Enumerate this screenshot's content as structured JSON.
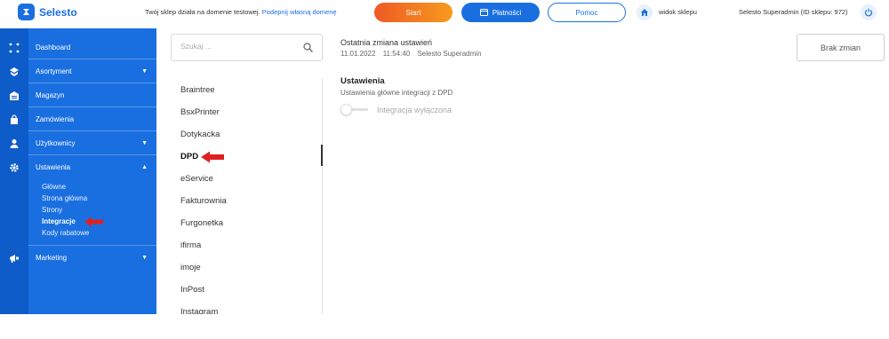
{
  "topbar": {
    "logo_text": "Selesto",
    "domain_note": "Twój sklep działa na domenie testowej.",
    "domain_link": "Podepnij własną domenę",
    "start_label": "Start",
    "payments_label": "Płatności",
    "help_label": "Pomoc",
    "shop_view_label": "widok sklepu",
    "user_info": "Selesto Superadmin (ID sklepu: 972)"
  },
  "sidebar": {
    "items": [
      {
        "label": "Dashboard"
      },
      {
        "label": "Asortyment",
        "caret": "▼"
      },
      {
        "label": "Magazyn"
      },
      {
        "label": "Zamówienia"
      },
      {
        "label": "Użytkownicy",
        "caret": "▼"
      },
      {
        "label": "Ustawienia",
        "caret": "▲"
      },
      {
        "label": "Marketing",
        "caret": "▼"
      }
    ],
    "subitems": [
      {
        "label": "Główne"
      },
      {
        "label": "Strona główna"
      },
      {
        "label": "Strony"
      },
      {
        "label": "Integracje",
        "active": true
      },
      {
        "label": "Kody rabatowe"
      }
    ]
  },
  "search": {
    "placeholder": "Szukaj ..."
  },
  "integrations": {
    "items": [
      "Braintree",
      "BsxPrinter",
      "Dotykacka",
      "DPD",
      "eService",
      "Fakturownia",
      "Furgonetka",
      "ifirma",
      "imoje",
      "InPost",
      "Instagram"
    ],
    "active": "DPD"
  },
  "header": {
    "last_change_label": "Ostatnia zmiana ustawień",
    "date": "11.01.2022",
    "time": "11:54:40",
    "author": "Selesto Superadmin",
    "no_changes_label": "Brak zmian"
  },
  "settings": {
    "title": "Ustawienia",
    "subtitle": "Ustawienia główne integracji z DPD",
    "toggle_label": "Integracja wyłączona",
    "toggle_on": false
  },
  "colors": {
    "brand_blue": "#1a6fe0",
    "sidebar_dark": "#0e5cc9",
    "start_orange": "#ee5a24",
    "annotation_red": "#e02020"
  }
}
